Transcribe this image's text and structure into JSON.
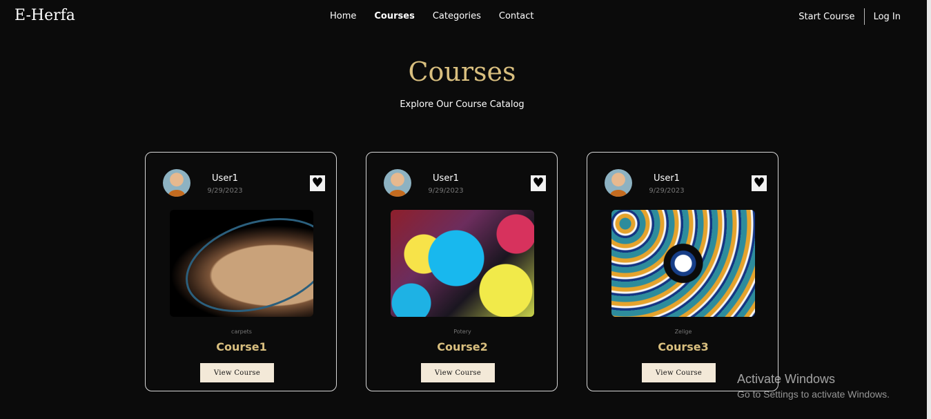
{
  "brand": {
    "logo": "E-Herfa"
  },
  "nav": {
    "items": [
      "Home",
      "Courses",
      "Categories",
      "Contact"
    ],
    "active": "Courses"
  },
  "auth": {
    "start_course": "Start Course",
    "login": "Log In"
  },
  "page": {
    "title": "Courses",
    "subtitle": "Explore Our Course Catalog"
  },
  "courses": [
    {
      "author": "User1",
      "date": "9/29/2023",
      "category": "carpets",
      "title": "Course1",
      "button": "View Course"
    },
    {
      "author": "User1",
      "date": "9/29/2023",
      "category": "Potery",
      "title": "Course2",
      "button": "View Course"
    },
    {
      "author": "User1",
      "date": "9/29/2023",
      "category": "Zelige",
      "title": "Course3",
      "button": "View Course"
    }
  ],
  "watermark": {
    "line1": "Activate Windows",
    "line2": "Go to Settings to activate Windows."
  },
  "colors": {
    "background": "#0b0b0b",
    "accent": "#d9bf7f",
    "button": "#f3e9d8"
  },
  "icons": {
    "favorite": "heart-icon"
  }
}
